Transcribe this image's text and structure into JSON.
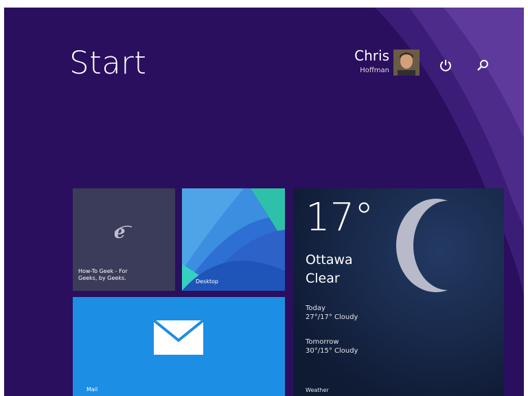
{
  "start": {
    "title": "Start"
  },
  "user": {
    "first_name": "Chris",
    "last_name": "Hoffman"
  },
  "icons": {
    "power": "power-icon",
    "search": "search-icon"
  },
  "tiles": {
    "ie": {
      "label": "How-To Geek - For\nGeeks, by Geeks.",
      "icon": "internet-explorer-icon"
    },
    "desktop": {
      "label": "Desktop"
    },
    "mail": {
      "label": "Mail",
      "icon": "envelope-icon"
    },
    "weather": {
      "temperature": "17°",
      "city": "Ottawa",
      "condition": "Clear",
      "today_label": "Today",
      "today_forecast": "27°/17° Cloudy",
      "tomorrow_label": "Tomorrow",
      "tomorrow_forecast": "30°/15° Cloudy",
      "app_name": "Weather"
    }
  },
  "colors": {
    "background": "#2a0f5e",
    "ie_tile": "#3b3c59",
    "mail_tile": "#1c8ee3",
    "weather_tile": "#15233f"
  }
}
